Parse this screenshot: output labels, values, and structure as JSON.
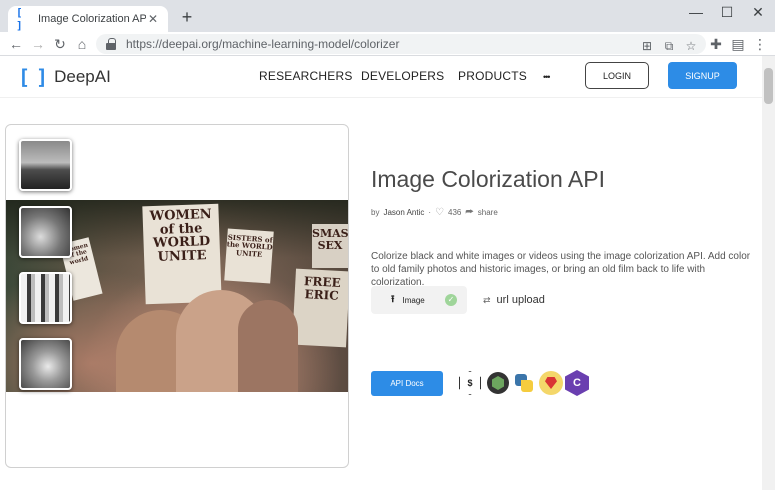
{
  "browser": {
    "tab_title": "Image Colorization API | DeepA",
    "tab_favicon": "[ ]",
    "tab_close": "✕",
    "new_tab": "+",
    "url": "https://deepai.org/machine-learning-model/colorizer",
    "window_controls": [
      "—",
      "☐",
      "✕"
    ],
    "nav": {
      "back": "←",
      "forward": "→",
      "reload": "↻",
      "home": "⌂"
    },
    "toolbar_icons": {
      "translate": "⊞",
      "screenshot": "⧉",
      "bookmark": "☆",
      "extensions": "✚",
      "profile": "▤",
      "menu": "⋮"
    }
  },
  "header": {
    "logo_left": "[",
    "logo_right": "]",
    "logo_text": "DeepAI",
    "nav": [
      "RESEARCHERS",
      "DEVELOPERS",
      "PRODUCTS",
      "•••"
    ],
    "login": "LOGIN",
    "signup": "SIGNUP"
  },
  "demo": {
    "signs": [
      {
        "text": "WOMEN of the WORLD UNITE"
      },
      {
        "text": "SISTERS of the WORLD UNITE"
      },
      {
        "text": "SMAS SEX"
      },
      {
        "text": "FREE ERIC"
      },
      {
        "text": "Women of the world"
      }
    ]
  },
  "main": {
    "title": "Image Colorization API",
    "by": "by",
    "author": "Jason Antic",
    "likes": "436",
    "share": "share",
    "description": "Colorize black and white images or videos using the image colorization API. Add color to old family photos and historic images, or bring an old film back to life with colorization.",
    "upload_label": "Image",
    "url_upload": "url upload",
    "api_docs": "API Docs",
    "languages": {
      "shell": "$",
      "csharp": "C"
    }
  }
}
